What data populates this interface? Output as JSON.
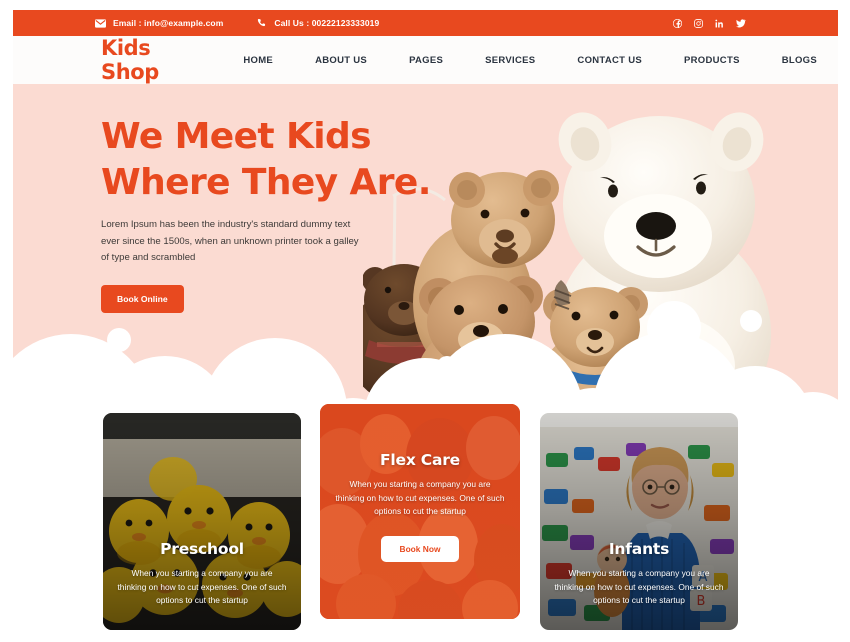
{
  "theme": {
    "accent": "#e8491f",
    "hero_bg": "#fbdbd2",
    "nav_bg": "#fdfcfb",
    "text_dark": "#2b3440",
    "white": "#ffffff"
  },
  "topbar": {
    "email": "Email : info@example.com",
    "phone": "Call Us : 00222123333019",
    "email_icon": "envelope-icon",
    "phone_icon": "phone-icon",
    "social": [
      {
        "name": "facebook-icon",
        "label": "Facebook"
      },
      {
        "name": "instagram-icon",
        "label": "Instagram"
      },
      {
        "name": "linkedin-icon",
        "label": "LinkedIn"
      },
      {
        "name": "twitter-icon",
        "label": "Twitter"
      }
    ]
  },
  "nav": {
    "logo": "Kids Shop",
    "links": [
      {
        "label": "HOME"
      },
      {
        "label": "ABOUT US"
      },
      {
        "label": "PAGES"
      },
      {
        "label": "SERVICES"
      },
      {
        "label": "CONTACT US"
      },
      {
        "label": "PRODUCTS"
      },
      {
        "label": "BLOGS"
      }
    ]
  },
  "hero": {
    "title_line1": "We Meet Kids",
    "title_line2": "Where They Are.",
    "paragraph": "Lorem Ipsum has been the industry's standard dummy text ever since the 1500s, when an unknown printer took a galley of type and scrambled",
    "cta": "Book Online",
    "art_alt": "teddy-bears-photo"
  },
  "cards": [
    {
      "title": "Preschool",
      "text": "When you starting a company you are thinking on how to cut expenses. One of such options to cut the startup",
      "image_alt": "rubber-ducks-photo",
      "has_button": false,
      "button": ""
    },
    {
      "title": "Flex Care",
      "text": "When you starting a company you are thinking on how to cut expenses. One of such options to cut the startup",
      "image_alt": "orange-toys-photo",
      "has_button": true,
      "button": "Book Now"
    },
    {
      "title": "Infants",
      "text": "When you starting a company you are thinking on how to cut expenses. One of such options to cut the startup",
      "image_alt": "teacher-clay-figure-toys-photo",
      "has_button": false,
      "button": ""
    }
  ]
}
